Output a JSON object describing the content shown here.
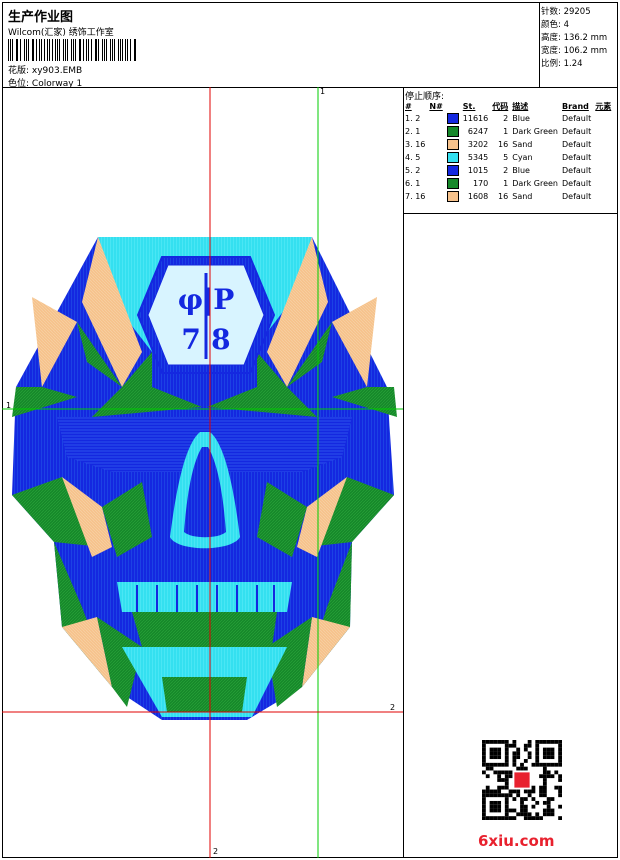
{
  "header": {
    "title": "生产作业图",
    "company": "Wilcom(汇家) 绣饰工作室",
    "design_label": "花版: ",
    "design_value": "xy903.EMB",
    "colorway_label": "色位: ",
    "colorway_value": "Colorway 1"
  },
  "stats": [
    {
      "label": "针数: ",
      "value": "29205"
    },
    {
      "label": "颜色: ",
      "value": "4"
    },
    {
      "label": "高度: ",
      "value": "136.2 mm"
    },
    {
      "label": "宽度: ",
      "value": "106.2 mm"
    },
    {
      "label": "比例: ",
      "value": "1.24"
    }
  ],
  "stop_sequence": {
    "title": "停止顺序:",
    "headers": [
      "#",
      "N#",
      "St.",
      "代码",
      "描述",
      "Brand",
      "元素"
    ],
    "rows": [
      {
        "idx": "1.",
        "n": "2",
        "color": "#1428e0",
        "st": "11616",
        "code": "2",
        "desc": "Blue",
        "brand": "Default"
      },
      {
        "idx": "2.",
        "n": "1",
        "color": "#16882a",
        "st": "6247",
        "code": "1",
        "desc": "Dark Green",
        "brand": "Default"
      },
      {
        "idx": "3.",
        "n": "16",
        "color": "#f6c28c",
        "st": "3202",
        "code": "16",
        "desc": "Sand",
        "brand": "Default"
      },
      {
        "idx": "4.",
        "n": "5",
        "color": "#34e0f0",
        "st": "5345",
        "code": "5",
        "desc": "Cyan",
        "brand": "Default"
      },
      {
        "idx": "5.",
        "n": "2",
        "color": "#1428e0",
        "st": "1015",
        "code": "2",
        "desc": "Blue",
        "brand": "Default"
      },
      {
        "idx": "6.",
        "n": "1",
        "color": "#16882a",
        "st": "170",
        "code": "1",
        "desc": "Dark Green",
        "brand": "Default"
      },
      {
        "idx": "7.",
        "n": "16",
        "color": "#f6c28c",
        "st": "1608",
        "code": "16",
        "desc": "Sand",
        "brand": "Default"
      }
    ]
  },
  "guides": {
    "v_green": "1",
    "h_green": "1",
    "h_red": "2",
    "v_red": "2"
  },
  "artwork": {
    "logo_top": "φ|P",
    "logo_bottom": "7|8"
  },
  "colors": {
    "blue": "#1428e0",
    "green": "#16882a",
    "sand": "#f6c28c",
    "cyan": "#34e0f0",
    "red_guide": "#e00000",
    "green_guide": "#00cc00"
  },
  "watermark": "6xiu.com"
}
